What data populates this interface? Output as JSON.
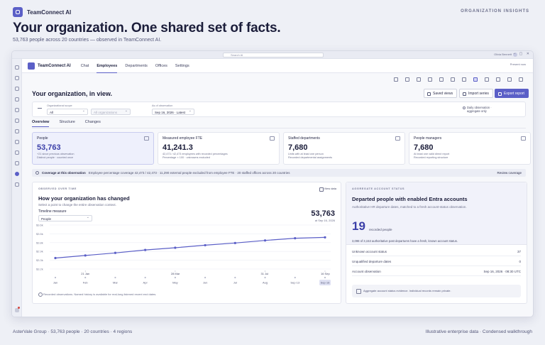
{
  "brand": {
    "name": "TeamConnect AI"
  },
  "eyebrow": "ORGANIZATION INSIGHTS",
  "hero": {
    "title": "Your organization. One shared set of facts.",
    "subtitle": "53,763 people across 20 countries — observed in TeamConnect AI."
  },
  "window": {
    "search_placeholder": "Search AI",
    "user_label": "Olivia Bennett",
    "app_name": "TeamConnect AI",
    "nav": [
      "Chat",
      "Employees",
      "Departments",
      "Offices",
      "Settings"
    ],
    "nav_active": "Employees",
    "app_right": "Present now"
  },
  "page": {
    "title": "Your organization, in view.",
    "buttons": {
      "saved_views": "Saved views",
      "import_series": "Import series",
      "export_report": "Export report"
    }
  },
  "filters": {
    "scope_label": "Organizational scope",
    "scope_value": "All",
    "org_value": "All organizations",
    "asof_label": "As of observation",
    "asof_value": "Sep 16, 2026 · Latest",
    "note": "Daily observation · aggregate only"
  },
  "subtabs": [
    "Overview",
    "Structure",
    "Changes"
  ],
  "kpis": [
    {
      "label": "People",
      "value": "53,763",
      "line1": "+21 since previous observation",
      "line2": "Distinct people · counted once"
    },
    {
      "label": "Measured employee FTE",
      "value": "41,241.3",
      "line1": "42,473 / 42,473 employees with recorded percentages",
      "line2": "Percentage × 100 · unknowns excluded"
    },
    {
      "label": "Staffed departments",
      "value": "7,680",
      "line1": "Units with at least one person",
      "line2": "Recorded departmental assignments"
    },
    {
      "label": "People managers",
      "value": "7,680",
      "line1": "At least one valid direct report",
      "line2": "Recorded reporting structure"
    }
  ],
  "coverage": {
    "title": "Coverage at this observation",
    "text": "Employee percentage coverage 42,473 / 42,473 · 11,290 external people excluded from employee FTE · 20 staffed offices across 20 countries",
    "link": "Review coverage"
  },
  "trend_card": {
    "eyebrow": "OBSERVED OVER TIME",
    "view_label": "View data",
    "title": "How your organization has changed",
    "subtitle": "Select a point to change the entire observation context.",
    "measure_label": "Timeline measure",
    "measure_value": "People",
    "big_value": "53,763",
    "big_sub": "at Sep 16, 2026",
    "footnote": "Recorded observations. Named history is available for real-long listened recent end dates."
  },
  "chart_data": {
    "type": "line",
    "x": [
      "Jan",
      "Feb",
      "Mar",
      "Apr",
      "May",
      "Jun",
      "Jul",
      "Aug",
      "Sep 13",
      "Sep 16"
    ],
    "event_labels": [
      "21 Jan",
      "28 Mar",
      "31 Jul",
      "16 Sep"
    ],
    "series": [
      {
        "values": [
          53.2,
          53.27,
          53.34,
          53.42,
          53.48,
          53.55,
          53.61,
          53.68,
          53.74,
          53.763
        ]
      }
    ],
    "y_ticks": [
      "$3.6k",
      "$3.5k",
      "$3.8k",
      "$2.9k",
      "$3.3k",
      "$3.2k"
    ],
    "x_ticks": [
      "Jan",
      "Feb",
      "Mar",
      "Apr",
      "May",
      "Jun",
      "Jul",
      "Aug",
      "Sep 13",
      "Sep 16"
    ],
    "selected": "Sep 16",
    "grid": true,
    "color": "#5b5fc7"
  },
  "account_card": {
    "eyebrow": "AGGREGATE ACCOUNT STATUS",
    "title": "Departed people with enabled Entra accounts",
    "subtitle": "Authoritative HR departure dates, matched to a fresh account-status observation.",
    "value": "19",
    "value_label": "recorded people",
    "desc": "3,098 of 3,153 authoritative past departures have a fresh, known account status.",
    "rows": [
      {
        "label": "Unknown account status",
        "value": "37"
      },
      {
        "label": "Unqualified departure dates",
        "value": "0"
      },
      {
        "label": "Account observation",
        "value": "Sep 16, 2026 · 08:30 UTC"
      }
    ],
    "note": "Aggregate account status evidence. Individual records remain private."
  },
  "footer": {
    "left": "AsterVale Group · 53,763 people · 20 countries · 4 regions",
    "right": "Illustrative enterprise data · Condensed walkthrough"
  },
  "colors": {
    "accent": "#5b5fc7",
    "accent_dark": "#3b3fa8"
  }
}
